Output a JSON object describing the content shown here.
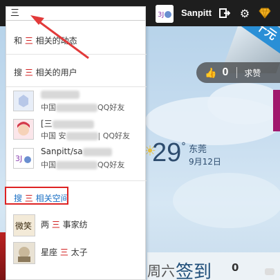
{
  "topbar": {
    "username": "Sanpitt",
    "icons": [
      "logout-icon",
      "gear-icon",
      "diamond-icon"
    ]
  },
  "search": {
    "value": "三"
  },
  "dropdown": {
    "search_dynamics": {
      "prefix": "和 ",
      "hl": "三",
      "suffix": " 相关的动态"
    },
    "search_users": {
      "prefix": "搜 ",
      "hl": "三",
      "suffix": " 相关的用户"
    },
    "users": [
      {
        "name": "",
        "info_prefix": "中国",
        "info_suffix": "QQ好友",
        "avatar": "default-avatar"
      },
      {
        "name": "[三",
        "info_prefix": "中国 安",
        "info_suffix": "| QQ好友",
        "avatar": "anime-girl-avatar"
      },
      {
        "name": "Sanpitt/sa",
        "info_prefix": "中国",
        "info_suffix": "QQ好友",
        "avatar": "sanpitt-avatar"
      }
    ],
    "search_spaces": {
      "prefix": "搜 ",
      "hl": "三",
      "suffix": " 相关空间"
    },
    "spaces": [
      {
        "prefix": "两 ",
        "hl": "三",
        "suffix": " 事家纺",
        "avatar": "weixiao-logo"
      },
      {
        "prefix": "星座 ",
        "hl": "三",
        "suffix": " 太子",
        "avatar": "prince-avatar"
      }
    ]
  },
  "background": {
    "ribbon_text": "十元",
    "like_count": "0",
    "ask_label": "求赞",
    "temperature": "29",
    "degree": "°",
    "city": "东莞",
    "date": "9月12日",
    "day_label": "周六",
    "checkin_label": "签到",
    "checkin_count": "0"
  },
  "colors": {
    "highlight": "#cc0000",
    "annotation": "#dd2222",
    "link": "#1a6fc4"
  }
}
